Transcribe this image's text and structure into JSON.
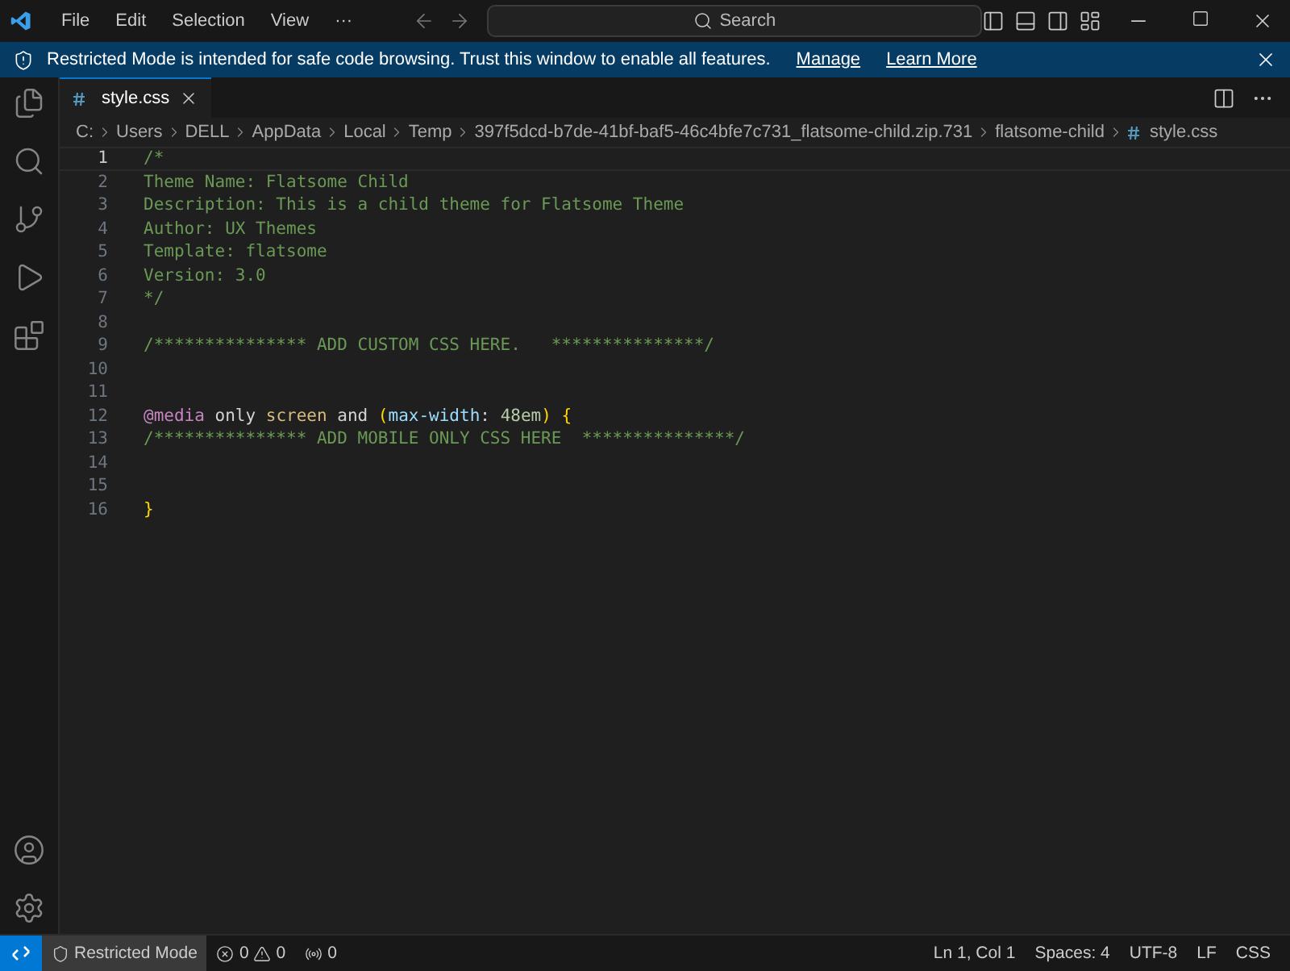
{
  "title_bar": {
    "menu": [
      "File",
      "Edit",
      "Selection",
      "View"
    ],
    "more": "···",
    "search": {
      "placeholder": "Search"
    }
  },
  "banner": {
    "message": "Restricted Mode is intended for safe code browsing. Trust this window to enable all features.",
    "links": [
      "Manage",
      "Learn More"
    ]
  },
  "activity_bar": {
    "top": [
      {
        "kind": "files"
      },
      {
        "kind": "search"
      },
      {
        "kind": "source-control"
      },
      {
        "kind": "run-debug"
      },
      {
        "kind": "extensions"
      }
    ],
    "bottom": [
      {
        "kind": "account"
      },
      {
        "kind": "settings"
      }
    ]
  },
  "tabs": [
    {
      "label": "style.css",
      "selected": true
    }
  ],
  "breadcrumb": [
    "C:",
    "Users",
    "DELL",
    "AppData",
    "Local",
    "Temp",
    "397f5dcd-b7de-41bf-baf5-46c4bfe7c731_flatsome-child.zip.731",
    "flatsome-child",
    "style.css"
  ],
  "editor": {
    "lines": [
      {
        "number": "1",
        "current": true,
        "tokens": [
          {
            "text": "/*",
            "kind": "comment"
          }
        ]
      },
      {
        "number": "2",
        "current": false,
        "tokens": [
          {
            "text": "Theme Name: Flatsome Child",
            "kind": "comment"
          }
        ]
      },
      {
        "number": "3",
        "current": false,
        "tokens": [
          {
            "text": "Description: This is a child theme for Flatsome Theme",
            "kind": "comment"
          }
        ]
      },
      {
        "number": "4",
        "current": false,
        "tokens": [
          {
            "text": "Author: UX Themes",
            "kind": "comment"
          }
        ]
      },
      {
        "number": "5",
        "current": false,
        "tokens": [
          {
            "text": "Template: flatsome",
            "kind": "comment"
          }
        ]
      },
      {
        "number": "6",
        "current": false,
        "tokens": [
          {
            "text": "Version: 3.0",
            "kind": "comment"
          }
        ]
      },
      {
        "number": "7",
        "current": false,
        "tokens": [
          {
            "text": "*/",
            "kind": "comment"
          }
        ]
      },
      {
        "number": "8",
        "current": false
      },
      {
        "number": "9",
        "current": false,
        "tokens": [
          {
            "text": "/*************** ADD CUSTOM CSS HERE.   ***************/",
            "kind": "comment"
          }
        ]
      },
      {
        "number": "10",
        "current": false
      },
      {
        "number": "11",
        "current": false
      },
      {
        "number": "12",
        "current": false,
        "tokens": [
          {
            "text": "@media",
            "kind": "keyword"
          },
          {
            "text": " only ",
            "kind": "plain"
          },
          {
            "text": "screen",
            "kind": "type"
          },
          {
            "text": " and ",
            "kind": "plain"
          },
          {
            "text": "(",
            "kind": "bracket"
          },
          {
            "text": "max-width",
            "kind": "property"
          },
          {
            "text": ": ",
            "kind": "plain"
          },
          {
            "text": "48em",
            "kind": "number"
          },
          {
            "text": ") {",
            "kind": "bracket"
          }
        ]
      },
      {
        "number": "13",
        "current": false,
        "tokens": [
          {
            "text": "/*************** ADD MOBILE ONLY CSS HERE  ***************/",
            "kind": "comment"
          }
        ]
      },
      {
        "number": "14",
        "current": false
      },
      {
        "number": "15",
        "current": false
      },
      {
        "number": "16",
        "current": false,
        "tokens": [
          {
            "text": "}",
            "kind": "bracket"
          }
        ]
      }
    ]
  },
  "status_bar": {
    "mode": "Restricted Mode",
    "errors": "0",
    "warnings": "0",
    "ports": "0",
    "right": [
      "Ln 1, Col 1",
      "Spaces: 4",
      "UTF-8",
      "LF",
      "CSS"
    ]
  }
}
